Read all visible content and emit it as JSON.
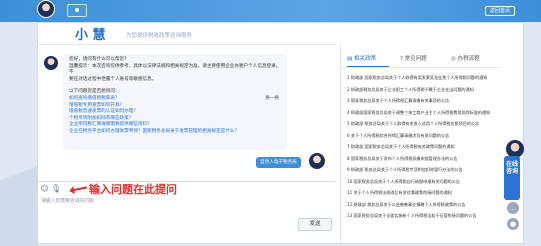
{
  "header": {
    "switch_label": "返回首页"
  },
  "brand": {
    "logo_text": "小 慧",
    "slogan": "为您提供税收政策咨询服务"
  },
  "bot_message": {
    "greeting_lines": [
      "您好，请问有什么可以帮您？",
      "温馨提示：本次咨询仅供参考，具体以法律法规和相关规定为准，请主要使用企业办税户个人信息登录。不",
      "要在对话过程中泄露个人账号等敏感信息。"
    ],
    "guess_title": "以下问题您是否想问问：",
    "swap_label": "换一换",
    "questions": [
      "如何查询增值税税率表？",
      "增值税专用发票如何开具？",
      "增值税普通发票的认证如何办理？",
      "个税专项附加扣除有哪些政策？",
      "企业所得税汇算清缴需要提供哪些资料？",
      "企业在税务平台如何办理发票申领？国家税务总局关于发票管理的相关规定是什么？"
    ]
  },
  "user_message": {
    "text": "自然人电子税务局"
  },
  "input": {
    "annotation": "输入问题在此提问",
    "placeholder": "请输入您需要咨询的问题",
    "send_label": "发送"
  },
  "right_panel": {
    "tabs": [
      {
        "label": "相关政策",
        "active": true
      },
      {
        "label": "常见问题",
        "active": false
      },
      {
        "label": "办税流程",
        "active": false
      }
    ],
    "policies": [
      "1 财政部 国家税务总局关于个人取得有奖发票奖金征免个人所得税问题的通知",
      "2 财政部税务总局关于企业职工个人所得税不属于企业支出问题的通知",
      "3 国家税务总局关于个人所得税汇算清缴有关事项的公告",
      "4 财政部国家税务总局关于调整个体工商户业主个人所得税费用扣除标准的通知",
      "5 财政部 税务总局关于个人取得有关收入适用个人所得税应税项目的公告",
      "6 关于个人所得税综合所得汇算清缴涉及有关问题的公告",
      "7 财政部 国家税务总局关于个人所得税有关政策问题的通知",
      "8 国家税务总局关于发布个人所得税扣缴申报管理办法的公告",
      "9 财政部 税务总局关于个人所得税专项附加扣除暂行办法的公告",
      "10 国家税务总局关于个人所得税自行纳税申报有关问题的公告",
      "11 关于个人所得税法修改后有关优惠政策衔接问题的通知",
      "12 财政部 税务总局关于公益慈善事业捐赠个人所得税政策的公告",
      "13 国家税务总局关于全面实施新个人所得税法若干征管衔接问题的公告"
    ]
  },
  "side": {
    "consult_label": "在线咨询",
    "icons": [
      "chat-icon",
      "user-icon"
    ]
  }
}
